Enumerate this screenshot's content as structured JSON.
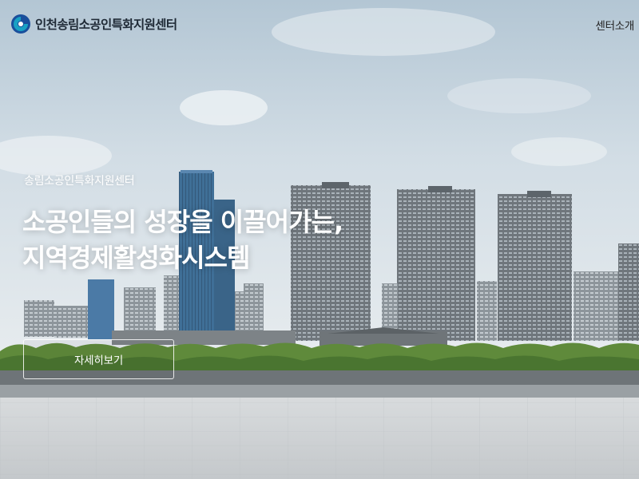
{
  "header": {
    "logo_text": "인천송림소공인특화지원센터",
    "nav": [
      {
        "label": "센터소개"
      }
    ]
  },
  "hero": {
    "subtitle": "송림소공인특화지원센터",
    "title_lines": [
      "소공인들의 성장을 이끌어가는,",
      "지역경제활성화시스템"
    ],
    "cta_label": "자세히보기"
  },
  "colors": {
    "brand_blue": "#1a4f9c",
    "brand_teal": "#19a1c4",
    "sky_top": "#b8c9d6",
    "sky_bottom": "#e3e9ee",
    "hero_text": "#ffffff"
  }
}
